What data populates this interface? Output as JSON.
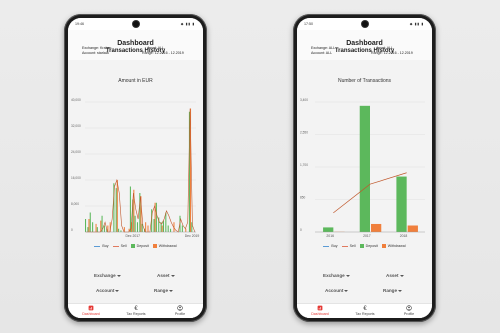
{
  "phones": [
    {
      "status": {
        "time": "19:46",
        "icons": "◆ ▮▮ ▮"
      },
      "header": {
        "title": "Dashboard",
        "subtitle": "Transactions History",
        "exchange": "Exchange: Kraken",
        "asset": "Asset: ALL",
        "account": "Account: starlala",
        "range": "Range: 12.2016 - 12.2019"
      },
      "chart_title": "Amount in EUR",
      "legend": [
        {
          "label": "Buy",
          "color": "#5b9bd5",
          "kind": "line"
        },
        {
          "label": "Sell",
          "color": "#e07a5f",
          "kind": "line"
        },
        {
          "label": "Deposit",
          "color": "#5cb85c",
          "kind": "box"
        },
        {
          "label": "Withdrawal",
          "color": "#f07f3c",
          "kind": "box"
        }
      ],
      "filters": {
        "exchange": "Exchange",
        "asset": "Asset",
        "account": "Account",
        "range": "Range"
      },
      "nav": {
        "dashboard": "Dashboard",
        "tax": "Tax Reports",
        "profile": "Profile"
      }
    },
    {
      "status": {
        "time": "17:50",
        "icons": "◆ ▮▮ ▮"
      },
      "header": {
        "title": "Dashboard",
        "subtitle": "Transactions History",
        "exchange": "Exchange: ALL",
        "asset": "Asset: ALL",
        "account": "Account: ALL",
        "range": "Range: 12.2016 - 12.2019"
      },
      "chart_title": "Number of Transactions",
      "legend": [
        {
          "label": "Buy",
          "color": "#5b9bd5",
          "kind": "line"
        },
        {
          "label": "Sell",
          "color": "#e07a5f",
          "kind": "line"
        },
        {
          "label": "Deposit",
          "color": "#5cb85c",
          "kind": "box"
        },
        {
          "label": "Withdrawal",
          "color": "#f07f3c",
          "kind": "box"
        }
      ],
      "filters": {
        "exchange": "Exchange",
        "asset": "Asset",
        "account": "Account",
        "range": "Range"
      },
      "nav": {
        "dashboard": "Dashboard",
        "tax": "Tax Reports",
        "profile": "Profile"
      }
    }
  ],
  "colors": {
    "deposit": "#5cb85c",
    "withdrawal": "#f07f3c",
    "sell": "#c0582c",
    "buy": "#5b9bd5",
    "active_nav": "#e53935"
  },
  "chart_data": [
    {
      "type": "bar",
      "title": "Amount in EUR",
      "xlabel": "",
      "ylabel": "",
      "ylim": [
        0,
        40000
      ],
      "yticks": [
        "40,000",
        "32,000",
        "24,000",
        "16,000",
        "8,000",
        "0"
      ],
      "xticks": [
        "Dec 2017",
        "Dec 2019"
      ],
      "deposit": [
        4000,
        1500,
        6000,
        3000,
        0,
        1500,
        0,
        5000,
        2000,
        1000,
        0,
        0,
        15000,
        13500,
        1000,
        500,
        0,
        0,
        0,
        14000,
        10000,
        5000,
        3000,
        12000,
        2500,
        1000,
        0,
        0,
        7000,
        4000,
        9000,
        4500,
        3000,
        3500,
        6000,
        2000,
        1000,
        0,
        0,
        0,
        5000,
        2000,
        0,
        0,
        37000,
        3000,
        0
      ],
      "withdrawal": [
        0,
        4000,
        0,
        0,
        2500,
        0,
        3500,
        0,
        0,
        2000,
        3000,
        0,
        0,
        16000,
        0,
        0,
        1500,
        0,
        1000,
        3000,
        13000,
        0,
        0,
        11000,
        0,
        3000,
        2000,
        0,
        0,
        9000,
        0,
        0,
        2000,
        0,
        0,
        0,
        0,
        3000,
        0,
        0,
        0,
        0,
        1000,
        0,
        38000,
        0,
        0
      ],
      "sell": [
        0,
        0,
        0,
        0,
        0,
        0,
        0,
        1000,
        3000,
        0,
        0,
        4000,
        14000,
        16000,
        12000,
        2000,
        0,
        0,
        0,
        1000,
        12000,
        7000,
        4000,
        11000,
        2000,
        0,
        0,
        0,
        6000,
        8000,
        5000,
        3000,
        2500,
        4000,
        6500,
        5000,
        3000,
        1500,
        500,
        0,
        4000,
        2000,
        1000,
        3000,
        38000,
        2000,
        0
      ]
    },
    {
      "type": "bar",
      "title": "Number of Transactions",
      "xlabel": "",
      "ylabel": "",
      "ylim": [
        0,
        3400
      ],
      "yticks": [
        "3,400",
        "2,550",
        "1,700",
        "850",
        "0"
      ],
      "categories": [
        "2016",
        "2017",
        "2018"
      ],
      "series": [
        {
          "name": "Deposit",
          "values": [
            120,
            3300,
            1450
          ]
        },
        {
          "name": "Withdrawal",
          "values": [
            5,
            210,
            170
          ]
        },
        {
          "name": "Sell",
          "values": [
            500,
            1250,
            1550
          ]
        }
      ]
    }
  ]
}
